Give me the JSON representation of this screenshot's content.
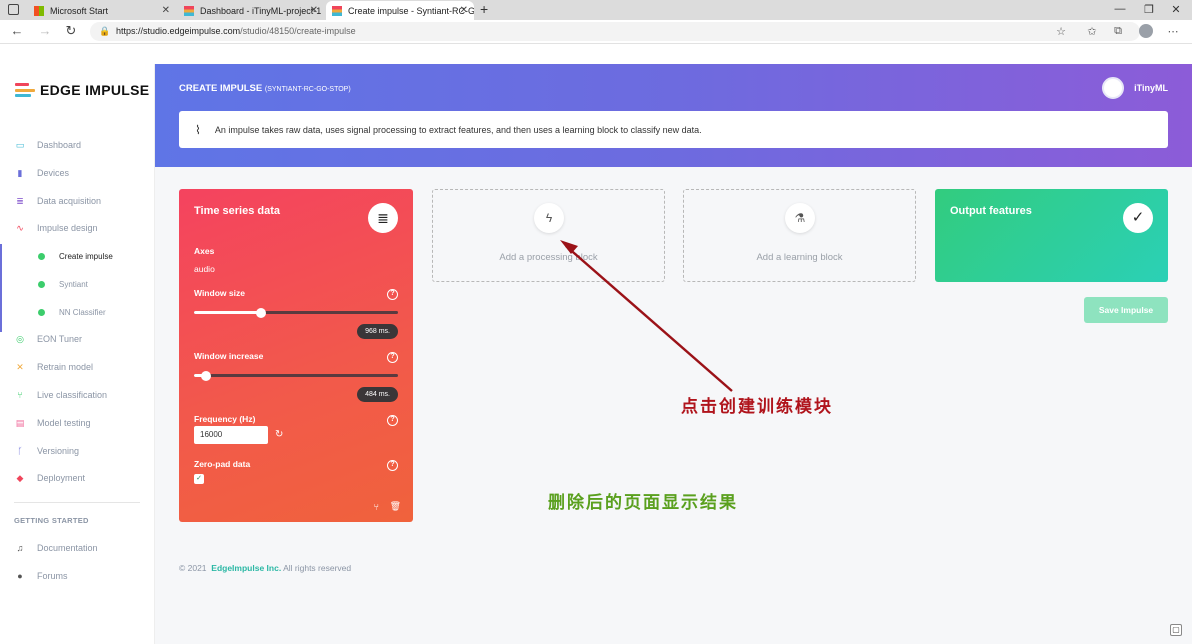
{
  "browser": {
    "tabs": [
      {
        "title": "Microsoft Start"
      },
      {
        "title": "Dashboard - iTinyML-project-1 -"
      },
      {
        "title": "Create impulse - Syntiant-RC-Go"
      }
    ],
    "new_tab": "+",
    "url_host": "https://studio.edgeimpulse.com",
    "url_path": "/studio/48150/create-impulse"
  },
  "sidebar": {
    "brand": "EDGE IMPULSE",
    "items": [
      {
        "label": "Dashboard",
        "icon": "monitor-icon",
        "color": "#3fb8d4"
      },
      {
        "label": "Devices",
        "icon": "devices-icon",
        "color": "#6b6fd9"
      },
      {
        "label": "Data acquisition",
        "icon": "database-icon",
        "color": "#7a48c9"
      },
      {
        "label": "Impulse design",
        "icon": "pulse-icon",
        "color": "#f0455b"
      }
    ],
    "subitems": [
      {
        "label": "Create impulse"
      },
      {
        "label": "Syntiant"
      },
      {
        "label": "NN Classifier"
      }
    ],
    "items2": [
      {
        "label": "EON Tuner",
        "icon": "compass-icon",
        "color": "#3ccd6c"
      },
      {
        "label": "Retrain model",
        "icon": "shuffle-icon",
        "color": "#f0a93c"
      },
      {
        "label": "Live classification",
        "icon": "branch-icon",
        "color": "#3ccd6c"
      },
      {
        "label": "Model testing",
        "icon": "clipboard-icon",
        "color": "#f06a9a"
      },
      {
        "label": "Versioning",
        "icon": "git-icon",
        "color": "#6b6fd9"
      },
      {
        "label": "Deployment",
        "icon": "cube-icon",
        "color": "#f0455b"
      }
    ],
    "section_label": "GETTING STARTED",
    "items3": [
      {
        "label": "Documentation",
        "icon": "book-icon",
        "color": "#555"
      },
      {
        "label": "Forums",
        "icon": "chat-icon",
        "color": "#555"
      }
    ]
  },
  "header": {
    "title": "CREATE IMPULSE",
    "project": "(SYNTIANT-RC-GO-STOP)",
    "user": "iTinyML",
    "info": "An impulse takes raw data, uses signal processing to extract features, and then uses a learning block to classify new data."
  },
  "time_series": {
    "title": "Time series data",
    "axes_label": "Axes",
    "axes_value": "audio",
    "window_size_label": "Window size",
    "window_size_value": "968 ms.",
    "window_size_fraction": 0.33,
    "window_increase_label": "Window increase",
    "window_increase_value": "484 ms.",
    "window_increase_fraction": 0.06,
    "frequency_label": "Frequency (Hz)",
    "frequency_value": "16000",
    "zero_pad_label": "Zero-pad data",
    "zero_pad_checked": true
  },
  "processing_block": {
    "label": "Add a processing block"
  },
  "learning_block": {
    "label": "Add a learning block"
  },
  "output": {
    "title": "Output features"
  },
  "save_label": "Save Impulse",
  "footer": {
    "year": "© 2021",
    "company": "EdgeImpulse Inc.",
    "rights": "All rights reserved"
  },
  "annotations": {
    "click_note": "点击创建训练模块",
    "result_note": "删除后的页面显示结果"
  }
}
